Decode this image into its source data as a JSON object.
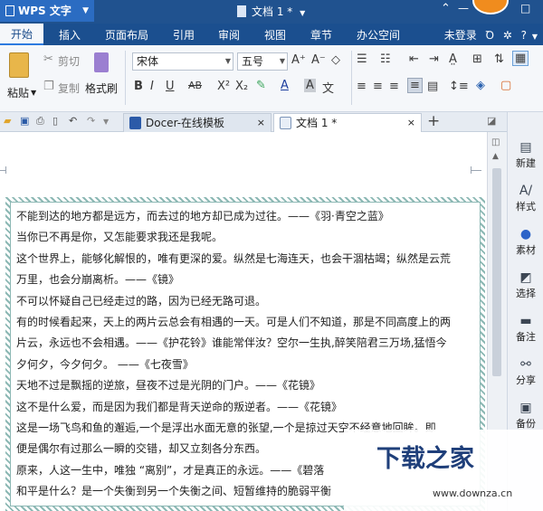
{
  "titlebar": {
    "app": "WPS 文字",
    "doc_title": "文档 1 *",
    "minimize": "—",
    "restore": "□"
  },
  "ribbon": {
    "tabs": [
      "开始",
      "插入",
      "页面布局",
      "引用",
      "审阅",
      "视图",
      "章节",
      "办公空间"
    ],
    "account": "未登录"
  },
  "toolbar": {
    "paste": "粘贴",
    "cut": "剪切",
    "copy": "复制",
    "format_painter": "格式刷",
    "font_name": "宋体",
    "font_size": "五号"
  },
  "doc_tabs": [
    {
      "label": "Docer-在线模板",
      "close": "×"
    },
    {
      "label": "文档 1 *",
      "close": "×"
    }
  ],
  "add_tab": "+",
  "document": {
    "lines": [
      "不能到达的地方都是远方，而去过的地方却已成为过往。——《羽·青空之蓝》",
      "当你已不再是你，又怎能要求我还是我呢。",
      "这个世界上，能够化解恨的，唯有更深的爱。纵然是七海连天，也会干涸枯竭；纵然是云荒",
      "万里，也会分崩离析。——《镜》",
      "不可以怀疑自己已经走过的路，因为已经无路可退。",
      "有的时候看起来，天上的两片云总会有相遇的一天。可是人们不知道，那是不同高度上的两",
      "片云，永远也不会相遇。——《护花铃》谁能常伴汝？空尔一生执,醉笑陪君三万场,猛悟今",
      "夕何夕，今夕何夕。 ——《七夜雪》",
      "天地不过是飘摇的逆旅，昼夜不过是光阴的门户。——《花镜》",
      "这不是什么爱，而是因为我们都是背天逆命的叛逆者。——《花镜》",
      "这是一场飞鸟和鱼的邂逅,一个是浮出水面无意的张望,一个是掠过天空不经意地回眸。即",
      "便是偶尔有过那么一瞬的交错，却又立刻各分东西。",
      "原来，人这一生中，唯独 “离别”，才是真正的永远。——《碧落",
      "和平是什么？是一个失衡到另一个失衡之间、短暂维持的脆弱平衡"
    ]
  },
  "right_panel": [
    "新建",
    "样式",
    "素材",
    "选择",
    "备注",
    "分享",
    "备份"
  ],
  "watermark": {
    "logo": "下载之家",
    "url": "www.downza.cn"
  }
}
